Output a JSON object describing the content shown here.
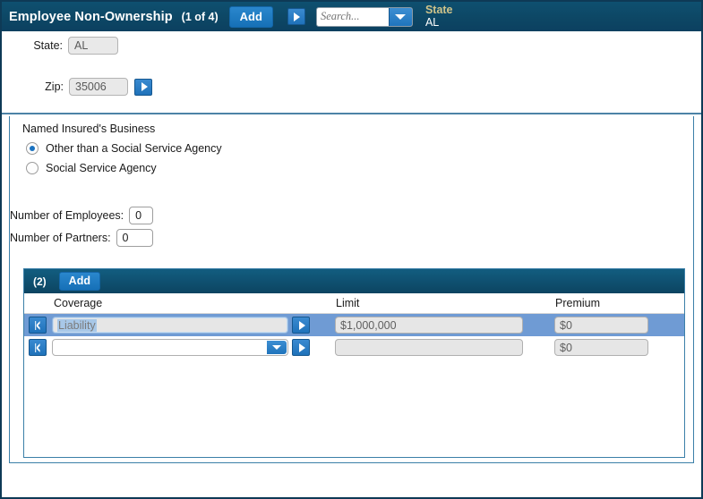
{
  "header": {
    "title": "Employee Non-Ownership",
    "count": "(1 of 4)",
    "add_label": "Add",
    "next_icon": "play-arrow-icon",
    "search": {
      "value": "",
      "placeholder": "Search...",
      "dropdown_icon": "chevron-down-icon"
    },
    "state_label": "State",
    "state_value": "AL"
  },
  "form": {
    "state": {
      "label": "State:",
      "value": "AL"
    },
    "zip": {
      "label": "Zip:",
      "value": "35006",
      "go_icon": "play-arrow-icon"
    }
  },
  "business": {
    "legend": "Named Insured's Business",
    "options": [
      {
        "label": "Other than a Social Service Agency",
        "selected": true
      },
      {
        "label": "Social Service Agency",
        "selected": false
      }
    ],
    "employees": {
      "label": "Number of Employees:",
      "value": "0"
    },
    "partners": {
      "label": "Number of Partners:",
      "value": "0"
    }
  },
  "grid": {
    "count": "(2)",
    "add_label": "Add",
    "columns": [
      "Coverage",
      "Limit",
      "Premium"
    ],
    "rows": [
      {
        "nav_icon": "previous-record-icon",
        "coverage": "Liability",
        "coverage_selected": true,
        "has_dropdown": false,
        "go_icon": "play-arrow-icon",
        "limit": "$1,000,000",
        "premium": "$0",
        "selected": true
      },
      {
        "nav_icon": "previous-record-icon",
        "coverage": "",
        "coverage_selected": false,
        "has_dropdown": true,
        "dropdown_icon": "chevron-down-icon",
        "go_icon": "play-arrow-icon",
        "limit": "",
        "premium": "$0",
        "selected": false
      }
    ]
  },
  "colors": {
    "header_bg": "#0d4a69",
    "accent_blue": "#1d7cc4",
    "row_selected": "#6f9bd4",
    "state_label": "#cfc38a",
    "panel_border": "#3b7fa8"
  }
}
